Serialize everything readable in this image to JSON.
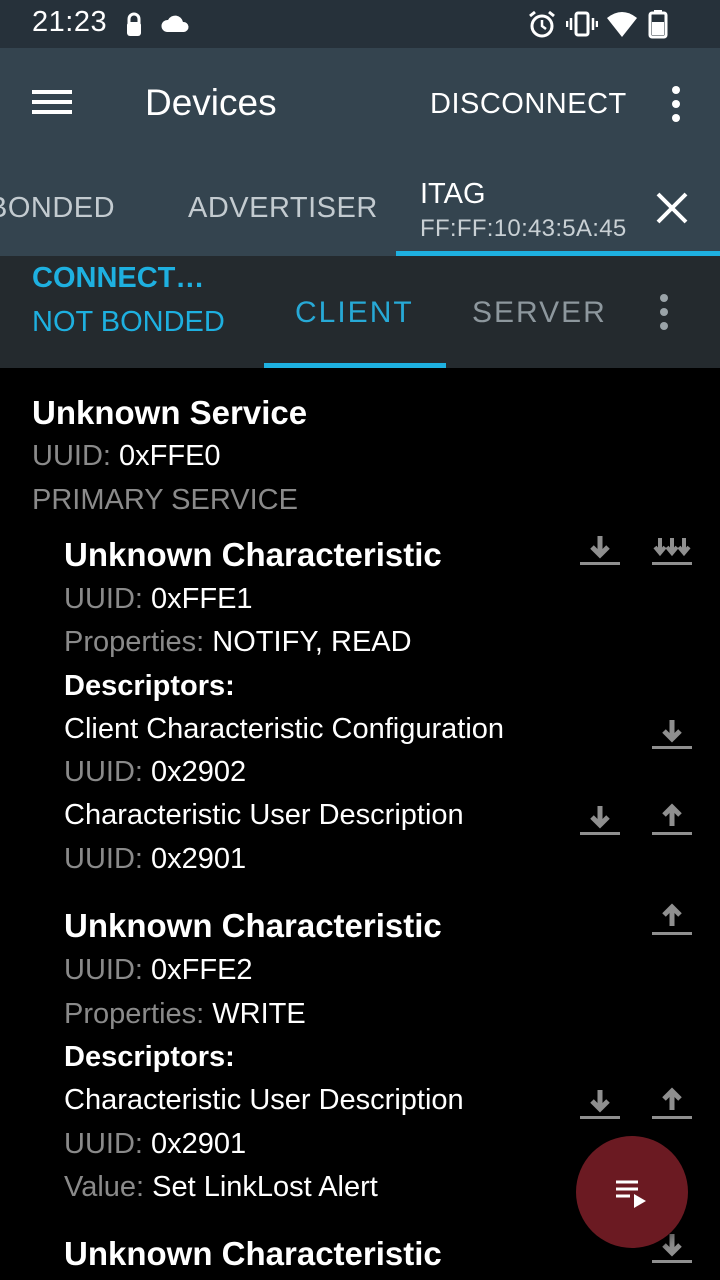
{
  "status_bar": {
    "time": "21:23",
    "icons": [
      "lock-icon",
      "cloud-icon",
      "alarm-icon",
      "vibrate-icon",
      "wifi-icon",
      "battery-icon"
    ]
  },
  "app_bar": {
    "title": "Devices",
    "disconnect_label": "DISCONNECT"
  },
  "tabs": {
    "bonded_label": "BONDED",
    "advertiser_label": "ADVERTISER",
    "device_name": "ITAG",
    "device_mac": "FF:FF:10:43:5A:45"
  },
  "connection": {
    "state": "CONNECT…",
    "bond_state": "NOT BONDED",
    "client_label": "CLIENT",
    "server_label": "SERVER"
  },
  "service": {
    "name": "Unknown Service",
    "uuid_label": "UUID:",
    "uuid": "0xFFE0",
    "type": "PRIMARY SERVICE"
  },
  "characteristics": [
    {
      "name": "Unknown Characteristic",
      "uuid_label": "UUID:",
      "uuid": "0xFFE1",
      "props_label": "Properties:",
      "properties": "NOTIFY, READ",
      "descriptors_label": "Descriptors:",
      "descriptors": [
        {
          "name": "Client Characteristic Configuration",
          "uuid_label": "UUID:",
          "uuid": "0x2902"
        },
        {
          "name": "Characteristic User Description",
          "uuid_label": "UUID:",
          "uuid": "0x2901"
        }
      ]
    },
    {
      "name": "Unknown Characteristic",
      "uuid_label": "UUID:",
      "uuid": "0xFFE2",
      "props_label": "Properties:",
      "properties": "WRITE",
      "descriptors_label": "Descriptors:",
      "descriptors": [
        {
          "name": "Characteristic User Description",
          "uuid_label": "UUID:",
          "uuid": "0x2901",
          "value_label": "Value:",
          "value": "Set LinkLost Alert"
        }
      ]
    },
    {
      "name": "Unknown Characteristic"
    }
  ],
  "colors": {
    "status_bar": "#26313a",
    "app_bar": "#34444f",
    "connection_bar": "#242a2e",
    "accent": "#1eb0e0",
    "fab": "#6b1a22",
    "background": "#000000"
  }
}
